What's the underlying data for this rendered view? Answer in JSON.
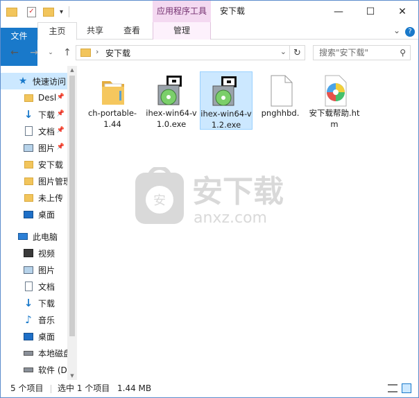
{
  "titlebar": {
    "context_tab": "应用程序工具",
    "title": "安下载",
    "minimize": "—",
    "maximize": "☐",
    "close": "✕"
  },
  "ribbon": {
    "tabs": [
      "文件",
      "主页",
      "共享",
      "查看",
      "管理"
    ],
    "expand_glyph": "⌄",
    "help_glyph": "?"
  },
  "address": {
    "crumb": "安下载",
    "search_placeholder": "搜索\"安下载\""
  },
  "sidebar": {
    "items": [
      {
        "label": "快速访问",
        "icon": "star-icon",
        "selected": true
      },
      {
        "label": "Desl",
        "icon": "folder-icon",
        "pinned": true
      },
      {
        "label": "下载",
        "icon": "download-icon",
        "pinned": true
      },
      {
        "label": "文档",
        "icon": "document-icon",
        "pinned": true
      },
      {
        "label": "图片",
        "icon": "picture-icon",
        "pinned": true
      },
      {
        "label": "安下载",
        "icon": "folder-icon"
      },
      {
        "label": "图片管理",
        "icon": "folder-icon"
      },
      {
        "label": "未上传",
        "icon": "folder-icon"
      },
      {
        "label": "桌面",
        "icon": "desktop-icon"
      },
      {
        "label": "此电脑",
        "icon": "computer-icon"
      },
      {
        "label": "视频",
        "icon": "video-icon"
      },
      {
        "label": "图片",
        "icon": "picture-icon"
      },
      {
        "label": "文档",
        "icon": "document-icon"
      },
      {
        "label": "下载",
        "icon": "download-icon"
      },
      {
        "label": "音乐",
        "icon": "music-icon"
      },
      {
        "label": "桌面",
        "icon": "desktop-icon"
      },
      {
        "label": "本地磁盘",
        "icon": "drive-icon"
      },
      {
        "label": "软件 (D",
        "icon": "drive-icon"
      }
    ]
  },
  "files": [
    {
      "name": "ch-portable-1.44",
      "icon": "folder-icon"
    },
    {
      "name": "ihex-win64-v1.0.exe",
      "icon": "installer-icon"
    },
    {
      "name": "ihex-win64-v1.2.exe",
      "icon": "installer-icon",
      "selected": true
    },
    {
      "name": "pnghhbd.",
      "icon": "blank-file-icon"
    },
    {
      "name": "安下载帮助.htm",
      "icon": "browser-icon"
    }
  ],
  "watermark": {
    "big": "安下载",
    "small": "anxz.com"
  },
  "status": {
    "count": "5 个项目",
    "selection": "选中 1 个项目",
    "size": "1.44 MB"
  },
  "colors": {
    "accent": "#1979ca",
    "selection": "#cce8ff",
    "context": "#f4d9f1"
  }
}
